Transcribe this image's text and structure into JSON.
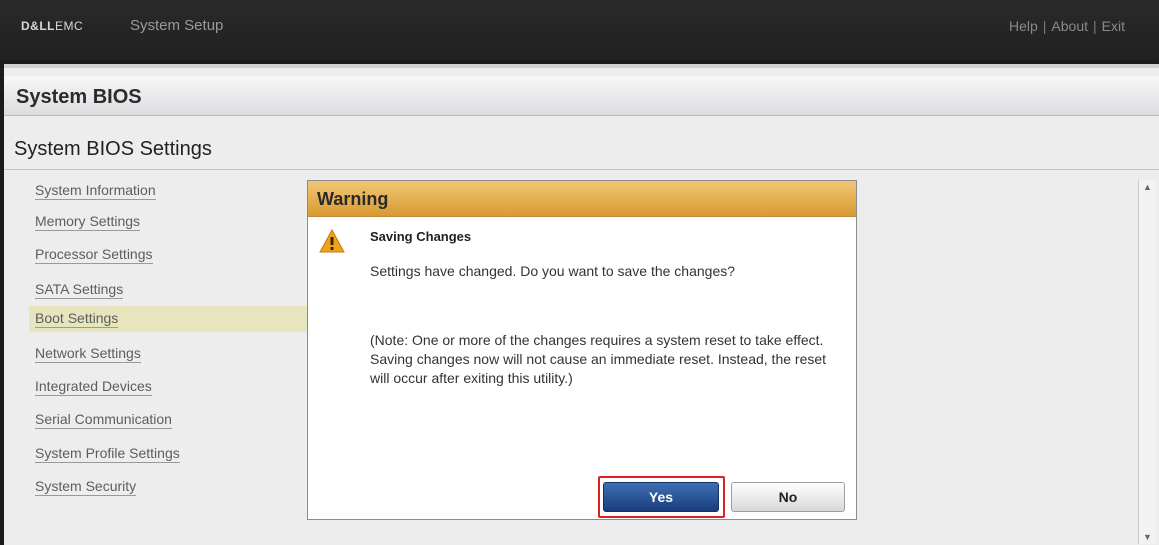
{
  "topbar": {
    "brand_dell": "D&LL",
    "brand_emc": "EMC",
    "app_title": "System Setup",
    "links": [
      "Help",
      "About",
      "Exit"
    ],
    "separator": "|"
  },
  "page": {
    "header": "System BIOS",
    "section_title": "System BIOS Settings"
  },
  "nav": {
    "items": [
      "System Information",
      "Memory Settings",
      "Processor Settings",
      "SATA Settings",
      "Boot Settings",
      "Network Settings",
      "Integrated Devices",
      "Serial Communication",
      "System Profile Settings",
      "System Security"
    ],
    "selected": "Boot Settings"
  },
  "dialog": {
    "title": "Warning",
    "heading": "Saving Changes",
    "message": "Settings have changed. Do you want to save the changes?",
    "note": "(Note: One or more of the changes requires a system reset to take effect. Saving changes now will not cause an immediate reset. Instead, the reset will occur after exiting this utility.)",
    "yes_label": "Yes",
    "no_label": "No"
  },
  "colors": {
    "dialog_header": "#e0a640",
    "yes_button": "#24498a",
    "highlight": "#e02020",
    "selected_nav": "#e6e5be"
  }
}
